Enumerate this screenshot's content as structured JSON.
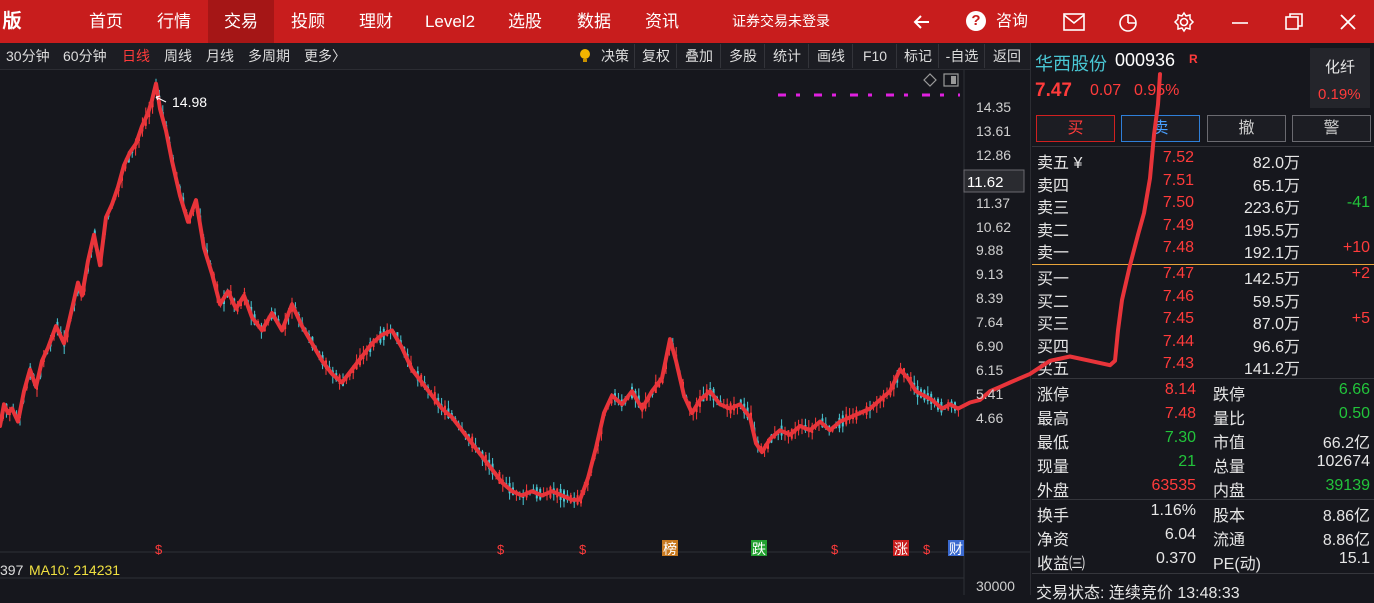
{
  "topbar": {
    "brand": "版",
    "nav": [
      "首页",
      "行情",
      "交易",
      "投顾",
      "理财",
      "Level2",
      "选股",
      "数据",
      "资讯"
    ],
    "active": "交易",
    "notice": "证券交易未登录",
    "consult": "咨询"
  },
  "toolbar": {
    "periods": [
      "30分钟",
      "60分钟",
      "日线",
      "周线",
      "月线",
      "多周期",
      "更多〉"
    ],
    "active_period": "日线",
    "tools": [
      "决策",
      "复权",
      "叠加",
      "多股",
      "统计",
      "画线",
      "F10",
      "标记",
      "-自选",
      "返回"
    ]
  },
  "chart": {
    "y_ticks": [
      "14.35",
      "13.61",
      "12.86",
      "12.12",
      "11.37",
      "10.62",
      "9.88",
      "9.13",
      "8.39",
      "7.64",
      "6.90",
      "6.15",
      "5.41",
      "4.66"
    ],
    "high_label": "14.98",
    "crosshair_label": "11.62",
    "events": [
      "$",
      "$",
      "$",
      "榜",
      "跌",
      "$",
      "涨",
      "$",
      "财"
    ],
    "ma_prev": "397",
    "ma10": "MA10: 214231",
    "vol_tick": "30000",
    "price_path": [
      [
        0,
        7.1
      ],
      [
        4,
        7.6
      ],
      [
        8,
        7.4
      ],
      [
        12,
        7.5
      ],
      [
        18,
        7.2
      ],
      [
        24,
        7.9
      ],
      [
        30,
        8.4
      ],
      [
        36,
        8.0
      ],
      [
        42,
        8.6
      ],
      [
        48,
        8.9
      ],
      [
        56,
        9.4
      ],
      [
        64,
        9.0
      ],
      [
        72,
        9.8
      ],
      [
        78,
        10.4
      ],
      [
        82,
        10.1
      ],
      [
        88,
        10.9
      ],
      [
        94,
        11.5
      ],
      [
        100,
        10.8
      ],
      [
        106,
        11.9
      ],
      [
        112,
        12.2
      ],
      [
        118,
        12.6
      ],
      [
        124,
        13.1
      ],
      [
        130,
        13.4
      ],
      [
        136,
        13.6
      ],
      [
        142,
        14.0
      ],
      [
        148,
        14.3
      ],
      [
        152,
        14.6
      ],
      [
        156,
        14.98
      ],
      [
        160,
        14.4
      ],
      [
        166,
        13.9
      ],
      [
        172,
        13.2
      ],
      [
        180,
        12.4
      ],
      [
        188,
        11.8
      ],
      [
        196,
        12.3
      ],
      [
        204,
        11.2
      ],
      [
        212,
        10.6
      ],
      [
        220,
        9.9
      ],
      [
        228,
        10.2
      ],
      [
        236,
        9.8
      ],
      [
        244,
        10.1
      ],
      [
        252,
        9.6
      ],
      [
        262,
        9.3
      ],
      [
        272,
        9.7
      ],
      [
        282,
        9.3
      ],
      [
        292,
        9.9
      ],
      [
        302,
        9.4
      ],
      [
        312,
        9.0
      ],
      [
        322,
        8.6
      ],
      [
        332,
        8.3
      ],
      [
        342,
        8.1
      ],
      [
        352,
        8.4
      ],
      [
        362,
        8.7
      ],
      [
        372,
        9.0
      ],
      [
        382,
        9.2
      ],
      [
        392,
        9.3
      ],
      [
        402,
        8.9
      ],
      [
        412,
        8.4
      ],
      [
        422,
        8.1
      ],
      [
        432,
        7.8
      ],
      [
        442,
        7.5
      ],
      [
        452,
        7.3
      ],
      [
        462,
        7.0
      ],
      [
        472,
        6.7
      ],
      [
        482,
        6.4
      ],
      [
        492,
        6.1
      ],
      [
        502,
        5.8
      ],
      [
        512,
        5.6
      ],
      [
        522,
        5.5
      ],
      [
        532,
        5.6
      ],
      [
        542,
        5.5
      ],
      [
        552,
        5.6
      ],
      [
        562,
        5.5
      ],
      [
        572,
        5.4
      ],
      [
        580,
        5.4
      ],
      [
        588,
        5.9
      ],
      [
        596,
        6.6
      ],
      [
        604,
        7.4
      ],
      [
        612,
        7.8
      ],
      [
        622,
        7.6
      ],
      [
        632,
        7.9
      ],
      [
        642,
        7.5
      ],
      [
        652,
        7.9
      ],
      [
        662,
        8.2
      ],
      [
        670,
        9.1
      ],
      [
        676,
        8.6
      ],
      [
        684,
        7.8
      ],
      [
        692,
        7.4
      ],
      [
        700,
        7.7
      ],
      [
        710,
        7.9
      ],
      [
        720,
        7.6
      ],
      [
        730,
        7.5
      ],
      [
        740,
        7.6
      ],
      [
        750,
        7.3
      ],
      [
        756,
        6.7
      ],
      [
        762,
        6.5
      ],
      [
        770,
        6.8
      ],
      [
        780,
        7.0
      ],
      [
        790,
        6.9
      ],
      [
        800,
        7.1
      ],
      [
        810,
        7.0
      ],
      [
        820,
        7.2
      ],
      [
        830,
        7.0
      ],
      [
        840,
        7.2
      ],
      [
        850,
        7.3
      ],
      [
        860,
        7.4
      ],
      [
        870,
        7.5
      ],
      [
        880,
        7.7
      ],
      [
        890,
        7.9
      ],
      [
        900,
        8.4
      ],
      [
        908,
        8.2
      ],
      [
        916,
        7.9
      ],
      [
        924,
        7.8
      ],
      [
        932,
        7.7
      ],
      [
        942,
        7.5
      ],
      [
        950,
        7.6
      ],
      [
        958,
        7.5
      ],
      [
        970,
        7.64
      ],
      [
        980,
        7.7
      ],
      [
        990,
        7.9
      ],
      [
        1000,
        8.0
      ],
      [
        1010,
        8.1
      ],
      [
        1020,
        8.2
      ],
      [
        1030,
        8.3
      ],
      [
        1050,
        8.6
      ],
      [
        1070,
        8.7
      ],
      [
        1090,
        8.6
      ],
      [
        1110,
        8.5
      ],
      [
        1115,
        8.6
      ],
      [
        1118,
        9.3
      ],
      [
        1122,
        10.0
      ],
      [
        1130,
        10.8
      ],
      [
        1138,
        11.5
      ],
      [
        1144,
        12.0
      ],
      [
        1150,
        12.8
      ],
      [
        1154,
        13.8
      ],
      [
        1158,
        14.5
      ],
      [
        1160,
        15.2
      ]
    ]
  },
  "quote": {
    "name": "华西股份",
    "code": "000936",
    "badge": "R",
    "price": "7.47",
    "change": "0.07",
    "change_pct": "0.95%",
    "sector": "化纤",
    "sector_pct": "0.19%",
    "buttons": [
      "买",
      "卖",
      "撤",
      "警"
    ],
    "sells": [
      {
        "label": "卖五 ¥",
        "price": "7.52",
        "vol": "82.0万",
        "delta": ""
      },
      {
        "label": "卖四",
        "price": "7.51",
        "vol": "65.1万",
        "delta": ""
      },
      {
        "label": "卖三",
        "price": "7.50",
        "vol": "223.6万",
        "delta": "-41"
      },
      {
        "label": "卖二",
        "price": "7.49",
        "vol": "195.5万",
        "delta": ""
      },
      {
        "label": "卖一",
        "price": "7.48",
        "vol": "192.1万",
        "delta": "+10"
      }
    ],
    "buys": [
      {
        "label": "买一",
        "price": "7.47",
        "vol": "142.5万",
        "delta": "+2"
      },
      {
        "label": "买二",
        "price": "7.46",
        "vol": "59.5万",
        "delta": ""
      },
      {
        "label": "买三",
        "price": "7.45",
        "vol": "87.0万",
        "delta": "+5"
      },
      {
        "label": "买四",
        "price": "7.44",
        "vol": "96.6万",
        "delta": ""
      },
      {
        "label": "买五",
        "price": "7.43",
        "vol": "141.2万",
        "delta": ""
      }
    ],
    "stats1": [
      [
        "涨停",
        "8.14",
        "跌停",
        "6.66"
      ],
      [
        "最高",
        "7.48",
        "量比",
        "0.50"
      ],
      [
        "最低",
        "7.30",
        "市值",
        "66.2亿"
      ],
      [
        "现量",
        "21",
        "总量",
        "102674"
      ],
      [
        "外盘",
        "63535",
        "内盘",
        "39139"
      ]
    ],
    "stats2": [
      [
        "换手",
        "1.16%",
        "股本",
        "8.86亿"
      ],
      [
        "净资",
        "6.04",
        "流通",
        "8.86亿"
      ],
      [
        "收益㈢",
        "0.370",
        "PE(动)",
        "15.1"
      ]
    ],
    "trade_status": "交易状态: 连续竞价 13:48:33"
  },
  "colors": {
    "up": "#ff3b3b",
    "down": "#22c43b",
    "accent": "#c81d1d",
    "cyan": "#49c7d4",
    "magenta": "#e020e0"
  }
}
